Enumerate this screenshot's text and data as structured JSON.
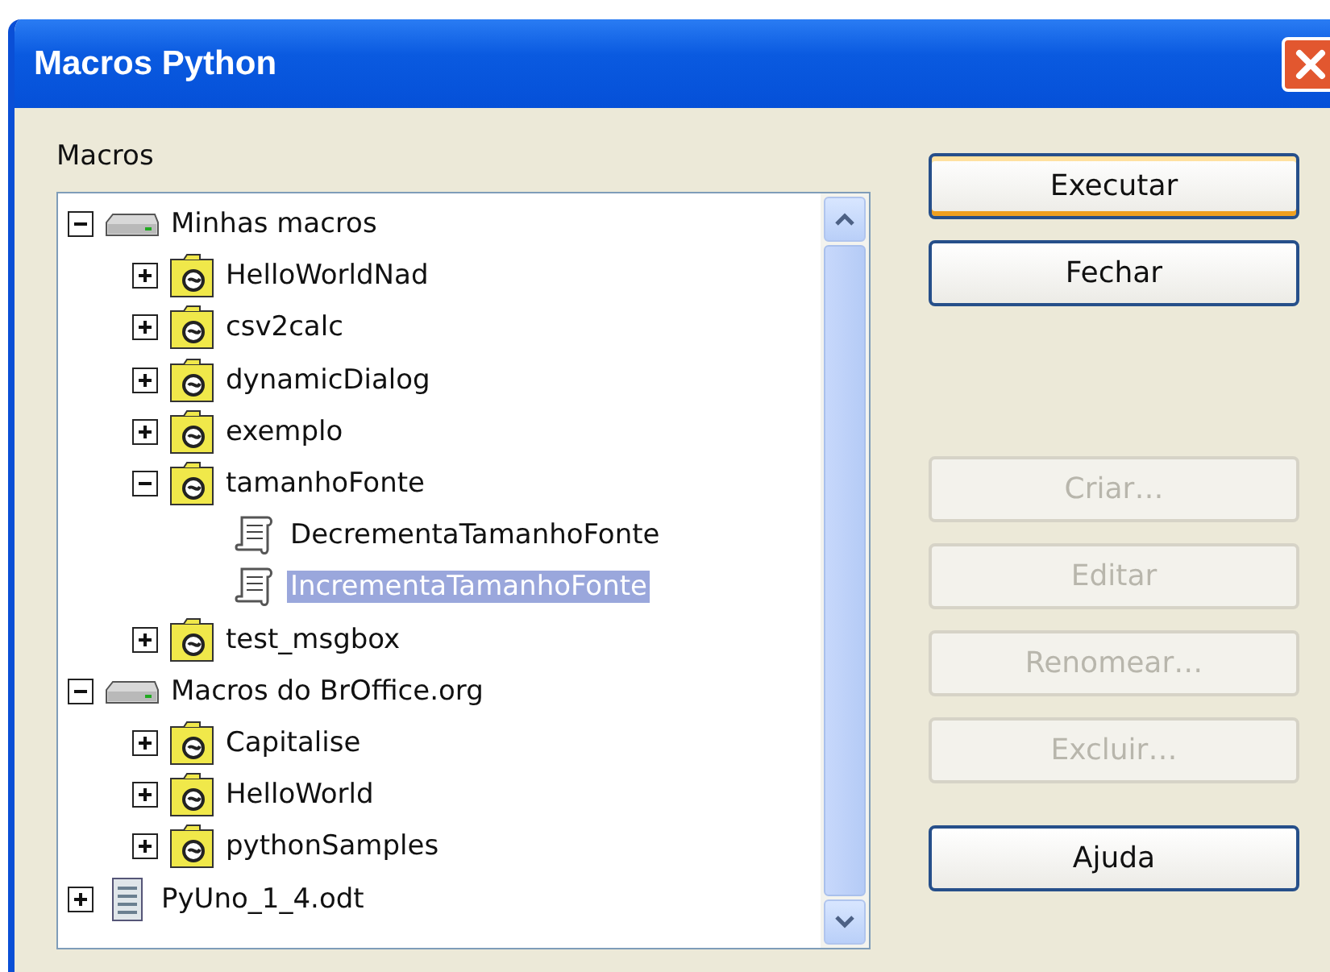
{
  "window": {
    "title": "Macros Python"
  },
  "tree_label": "Macros",
  "tree": [
    {
      "label": "Minhas macros",
      "kind": "library",
      "expanded": true,
      "selected": false,
      "children": [
        {
          "label": "HelloWorldNad",
          "kind": "module",
          "expanded": false,
          "selected": false
        },
        {
          "label": "csv2calc",
          "kind": "module",
          "expanded": false,
          "selected": false
        },
        {
          "label": "dynamicDialog",
          "kind": "module",
          "expanded": false,
          "selected": false
        },
        {
          "label": "exemplo",
          "kind": "module",
          "expanded": false,
          "selected": false
        },
        {
          "label": "tamanhoFonte",
          "kind": "module",
          "expanded": true,
          "selected": false,
          "children": [
            {
              "label": "DecrementaTamanhoFonte",
              "kind": "macro",
              "selected": false
            },
            {
              "label": "IncrementaTamanhoFonte",
              "kind": "macro",
              "selected": true
            }
          ]
        },
        {
          "label": "test_msgbox",
          "kind": "module",
          "expanded": false,
          "selected": false
        }
      ]
    },
    {
      "label": "Macros do BrOffice.org",
      "kind": "library",
      "expanded": true,
      "selected": false,
      "children": [
        {
          "label": "Capitalise",
          "kind": "module",
          "expanded": false,
          "selected": false
        },
        {
          "label": "HelloWorld",
          "kind": "module",
          "expanded": false,
          "selected": false
        },
        {
          "label": "pythonSamples",
          "kind": "module",
          "expanded": false,
          "selected": false
        }
      ]
    },
    {
      "label": "PyUno_1_4.odt",
      "kind": "document",
      "expanded": false,
      "selected": false
    }
  ],
  "buttons": [
    {
      "label": "Executar",
      "disabled": false,
      "focused": true
    },
    {
      "label": "Fechar",
      "disabled": false,
      "focused": false
    },
    {
      "label": "Criar…",
      "disabled": true,
      "focused": false
    },
    {
      "label": "Editar",
      "disabled": true,
      "focused": false
    },
    {
      "label": "Renomear…",
      "disabled": true,
      "focused": false
    },
    {
      "label": "Excluir…",
      "disabled": true,
      "focused": false
    },
    {
      "label": "Ajuda",
      "disabled": false,
      "focused": false
    }
  ]
}
